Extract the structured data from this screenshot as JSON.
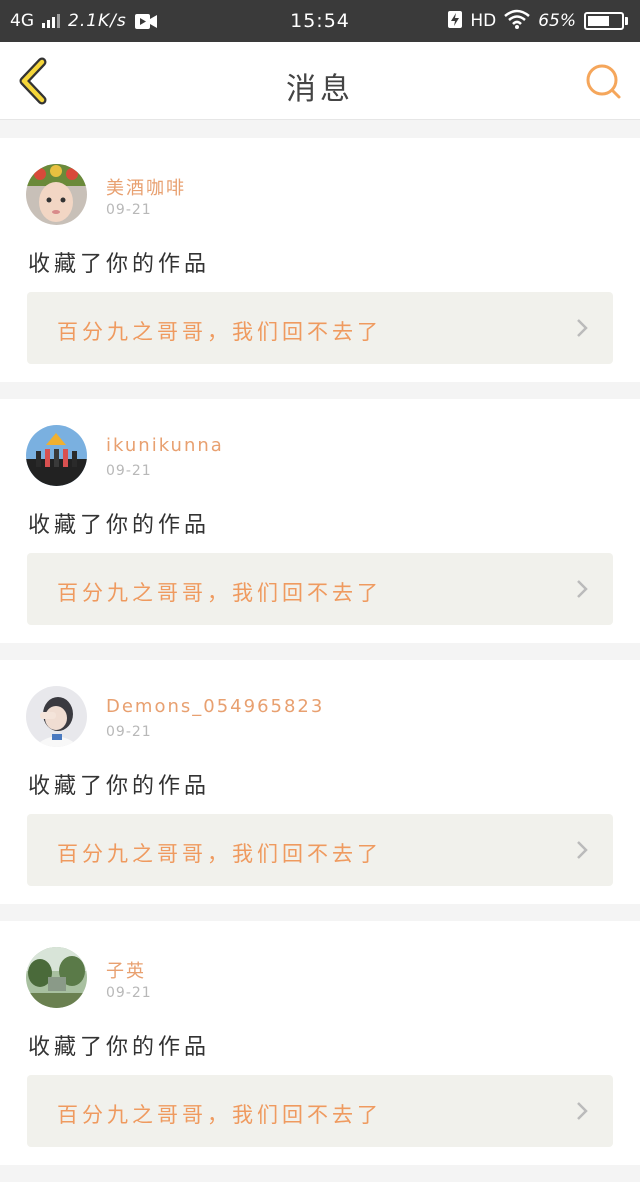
{
  "status_bar": {
    "network": "4G",
    "speed": "2.1K/s",
    "time": "15:54",
    "hd": "HD",
    "battery_text": "65%",
    "battery_level": 0.65
  },
  "navbar": {
    "title": "消息",
    "back_icon": "chevron-left-icon",
    "search_icon": "search-icon",
    "accent_color": "#f5a623"
  },
  "messages": [
    {
      "username": "美酒咖啡",
      "date": "09-21",
      "action": "收藏了你的作品",
      "work_title": "百分九之哥哥，我们回不去了"
    },
    {
      "username": "ikunikunna",
      "date": "09-21",
      "action": "收藏了你的作品",
      "work_title": "百分九之哥哥，我们回不去了"
    },
    {
      "username": "Demons_054965823",
      "date": "09-21",
      "action": "收藏了你的作品",
      "work_title": "百分九之哥哥，我们回不去了"
    },
    {
      "username": "子英",
      "date": "09-21",
      "action": "收藏了你的作品",
      "work_title": "百分九之哥哥，我们回不去了"
    }
  ],
  "colors": {
    "username": "#e8a070",
    "work_title": "#ef9a5f",
    "work_bg": "#f1f1ec"
  }
}
